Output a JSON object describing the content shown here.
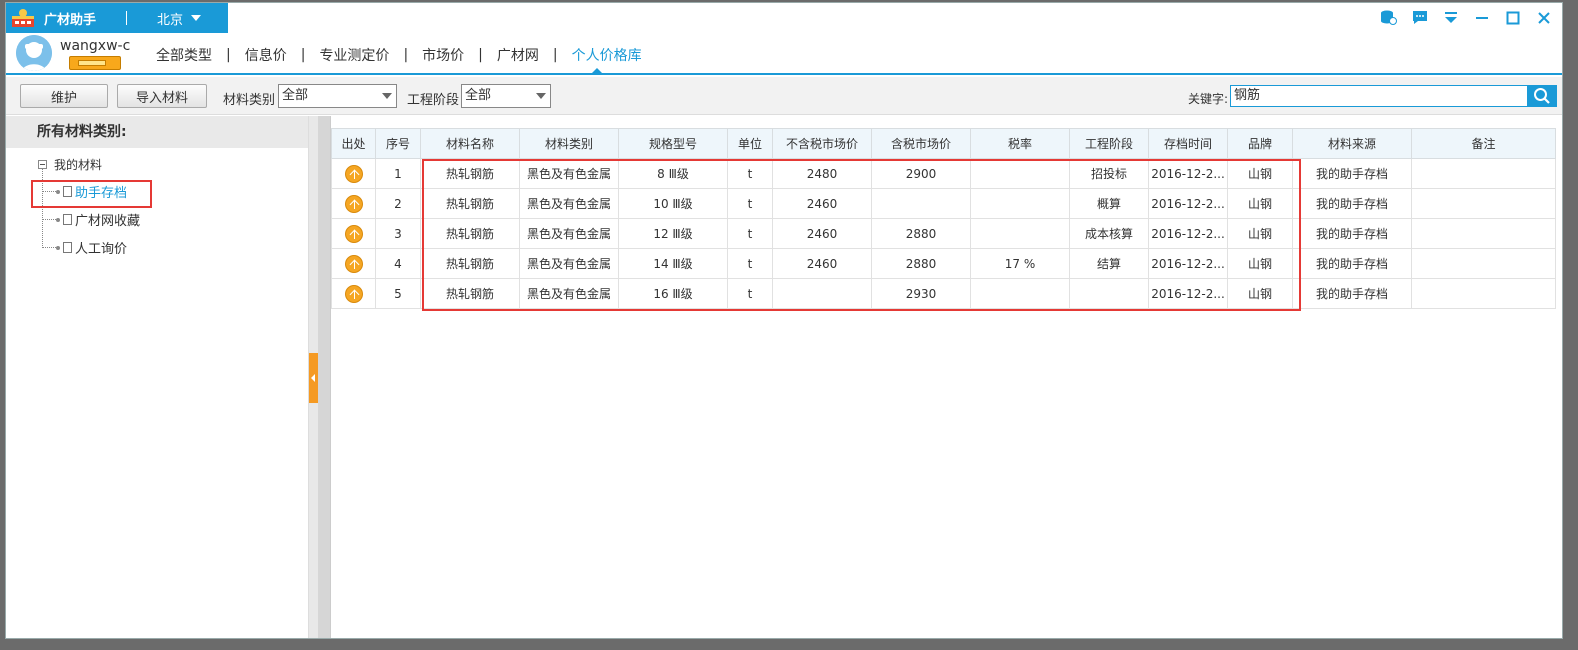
{
  "titlebar": {
    "app_name": "广材助手",
    "city": "北京",
    "controls": [
      "db-icon",
      "chat-icon",
      "dropdown-icon",
      "minimize-icon",
      "maximize-icon",
      "close-icon"
    ]
  },
  "user": {
    "name": "wangxw-c"
  },
  "nav": {
    "tabs": [
      {
        "label": "全部类型",
        "active": false
      },
      {
        "label": "信息价",
        "active": false
      },
      {
        "label": "专业测定价",
        "active": false
      },
      {
        "label": "市场价",
        "active": false
      },
      {
        "label": "广材网",
        "active": false
      },
      {
        "label": "个人价格库",
        "active": true
      }
    ]
  },
  "toolbar": {
    "maintain_label": "维护",
    "import_label": "导入材料",
    "category_label": "材料类别",
    "category_value": "全部",
    "stage_label": "工程阶段",
    "stage_value": "全部",
    "keyword_label": "关键字:",
    "keyword_value": "钢筋"
  },
  "sidebar": {
    "header": "所有材料类别:",
    "root": "我的材料",
    "items": [
      {
        "label": "助手存档",
        "selected": true
      },
      {
        "label": "广材网收藏",
        "selected": false
      },
      {
        "label": "人工询价",
        "selected": false
      }
    ]
  },
  "table": {
    "columns": [
      "出处",
      "序号",
      "材料名称",
      "材料类别",
      "规格型号",
      "单位",
      "不含税市场价",
      "含税市场价",
      "税率",
      "工程阶段",
      "存档时间",
      "品牌",
      "材料来源",
      "备注"
    ],
    "rows": [
      {
        "seq": "1",
        "name": "热轧钢筋",
        "category": "黑色及有色金属",
        "spec": "8 Ⅲ级",
        "unit": "t",
        "price_ex": "2480",
        "price_in": "2900",
        "tax": "",
        "stage": "招投标",
        "time": "2016-12-2...",
        "brand": "山钢",
        "source": "我的助手存档",
        "note": ""
      },
      {
        "seq": "2",
        "name": "热轧钢筋",
        "category": "黑色及有色金属",
        "spec": "10 Ⅲ级",
        "unit": "t",
        "price_ex": "2460",
        "price_in": "",
        "tax": "",
        "stage": "概算",
        "time": "2016-12-2...",
        "brand": "山钢",
        "source": "我的助手存档",
        "note": ""
      },
      {
        "seq": "3",
        "name": "热轧钢筋",
        "category": "黑色及有色金属",
        "spec": "12 Ⅲ级",
        "unit": "t",
        "price_ex": "2460",
        "price_in": "2880",
        "tax": "",
        "stage": "成本核算",
        "time": "2016-12-2...",
        "brand": "山钢",
        "source": "我的助手存档",
        "note": ""
      },
      {
        "seq": "4",
        "name": "热轧钢筋",
        "category": "黑色及有色金属",
        "spec": "14 Ⅲ级",
        "unit": "t",
        "price_ex": "2460",
        "price_in": "2880",
        "tax": "17 %",
        "stage": "结算",
        "time": "2016-12-2...",
        "brand": "山钢",
        "source": "我的助手存档",
        "note": ""
      },
      {
        "seq": "5",
        "name": "热轧钢筋",
        "category": "黑色及有色金属",
        "spec": "16 Ⅲ级",
        "unit": "t",
        "price_ex": "",
        "price_in": "2930",
        "tax": "",
        "stage": "",
        "time": "2016-12-2...",
        "brand": "山钢",
        "source": "我的助手存档",
        "note": ""
      }
    ]
  },
  "colors": {
    "accent": "#1a9ad7",
    "highlight_red": "#e53935",
    "origin_icon": "#f5a623"
  }
}
